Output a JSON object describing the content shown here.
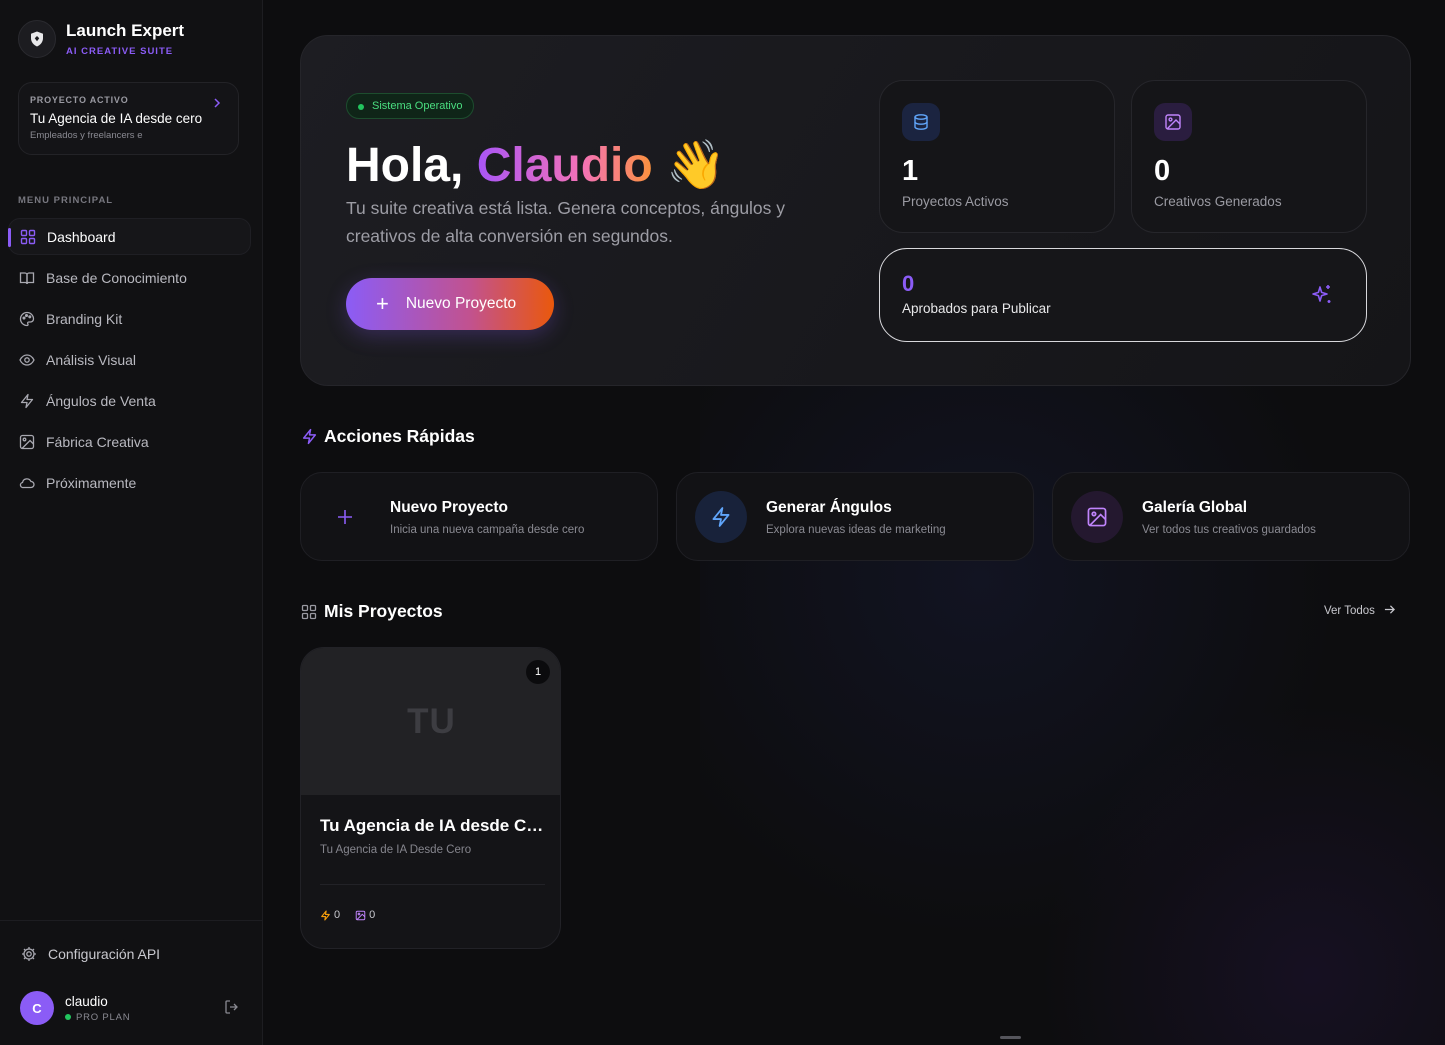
{
  "brand": {
    "name": "Launch Expert",
    "tagline": "AI CREATIVE SUITE"
  },
  "active_project": {
    "label": "PROYECTO ACTIVO",
    "title": "Tu Agencia de IA desde cero",
    "description": "Empleados y freelancers e"
  },
  "menu": {
    "label": "MENU PRINCIPAL",
    "items": [
      {
        "label": "Dashboard",
        "icon": "dashboard-grid-icon",
        "active": true
      },
      {
        "label": "Base de Conocimiento",
        "icon": "book-icon"
      },
      {
        "label": "Branding Kit",
        "icon": "palette-icon"
      },
      {
        "label": "Análisis Visual",
        "icon": "eye-icon"
      },
      {
        "label": "Ángulos de Venta",
        "icon": "lightning-icon"
      },
      {
        "label": "Fábrica Creativa",
        "icon": "image-icon"
      },
      {
        "label": "Próximamente",
        "icon": "cloud-icon"
      }
    ]
  },
  "footer": {
    "api_label": "Configuración API",
    "user": {
      "initial": "C",
      "name": "claudio",
      "plan": "PRO PLAN"
    }
  },
  "hero": {
    "status": "Sistema Operativo",
    "greeting": "Hola,",
    "name": "Claudio",
    "emoji": "👋",
    "description": "Tu suite creativa está lista. Genera conceptos, ángulos y creativos de alta conversión en segundos.",
    "cta_label": "Nuevo Proyecto"
  },
  "stats": {
    "projects": {
      "value": "1",
      "label": "Proyectos Activos"
    },
    "creatives": {
      "value": "0",
      "label": "Creativos Generados"
    },
    "approved": {
      "value": "0",
      "label": "Aprobados para Publicar"
    }
  },
  "quick_actions": {
    "title": "Acciones Rápidas",
    "items": [
      {
        "title": "Nuevo Proyecto",
        "desc": "Inicia una nueva campaña desde cero"
      },
      {
        "title": "Generar Ángulos",
        "desc": "Explora nuevas ideas de marketing"
      },
      {
        "title": "Galería Global",
        "desc": "Ver todos tus creativos guardados"
      }
    ]
  },
  "projects": {
    "title": "Mis Proyectos",
    "view_all": "Ver Todos",
    "items": [
      {
        "initials": "TU",
        "badge": "1",
        "title": "Tu Agencia de IA desde Cero",
        "subtitle": "Tu Agencia de IA Desde Cero",
        "angles": "0",
        "creatives": "0"
      }
    ]
  },
  "colors": {
    "accent": "#8b5cf6",
    "success": "#22c55e",
    "background": "#0d0d0f"
  }
}
